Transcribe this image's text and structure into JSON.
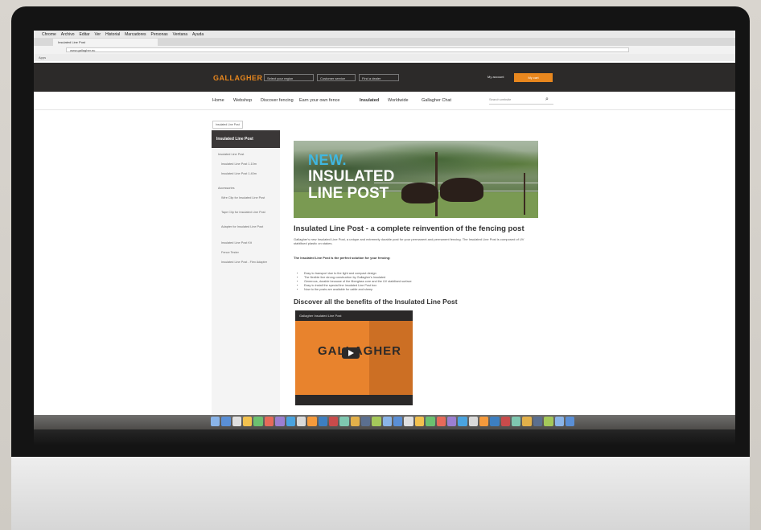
{
  "browser": {
    "menu": [
      "Chrome",
      "Archivo",
      "Editar",
      "Ver",
      "Historial",
      "Marcadores",
      "Personas",
      "Ventana",
      "Ayuda"
    ],
    "tab_title": "Insulated Line Post",
    "url": "www.gallagher.eu",
    "bookmarks": "Apps"
  },
  "site": {
    "logo": "GALLAGHER",
    "language_select": "Select your region",
    "country_select": "Customer service",
    "store_select": "Find a dealer",
    "login_link": "My account",
    "cart_button": "My cart"
  },
  "nav": {
    "items": [
      "Home",
      "Webshop",
      "Discover fencing",
      "Earn your own fence",
      "Insulated",
      "Worldwide",
      "Gallagher Chat"
    ],
    "search_placeholder": "Search website"
  },
  "breadcrumb": "Insulated Line Post",
  "sidebar": {
    "title": "Insulated Line Post",
    "items": [
      "Insulated Line Post",
      "Insulated Line Post 1.10m",
      "Insulated Line Post 1.40m",
      "Accessories",
      "Wire Clip for Insulated Line Post",
      "Tape Clip for Insulated Line Post",
      "Adapter for Insulated Line Post",
      "Insulated Line Post Kit",
      "Fence Tester",
      "Insulated Line Post - Flex Adapter"
    ]
  },
  "hero": {
    "new_label": "NEW.",
    "title": "INSULATED LINE POST"
  },
  "article": {
    "title": "Insulated Line Post - a complete reinvention of the fencing post",
    "intro": "Gallagher's new Insulated Line Post, a unique and extremely durable post for your permanent and permanent fencing. The Insulated Line Post is composed of UV stabilised plastic on stakes.",
    "subheading": "The Insulated Line Post is the perfect solution for your fencing:",
    "bullets": [
      "Easy to transport due to the light and compact design",
      "The flexible line strong construction by Gallagher's Insulated",
      "Generous, durable because of the fiberglass core and the UV stabilised surface",
      "Easy to install the special line Insulated Line Post box",
      "Now to the posts are available for cattle and sheep"
    ],
    "section_title": "Discover all the benefits of the Insulated Line Post"
  },
  "video": {
    "title": "Gallagher Insulated Line Post",
    "logo": "GALLAGHER"
  },
  "colors": {
    "brand_orange": "#e8871e",
    "header_dark": "#2c2a29",
    "hero_blue": "#3fb7e0"
  },
  "device": {
    "apple_logo": "apple-logo-icon"
  }
}
